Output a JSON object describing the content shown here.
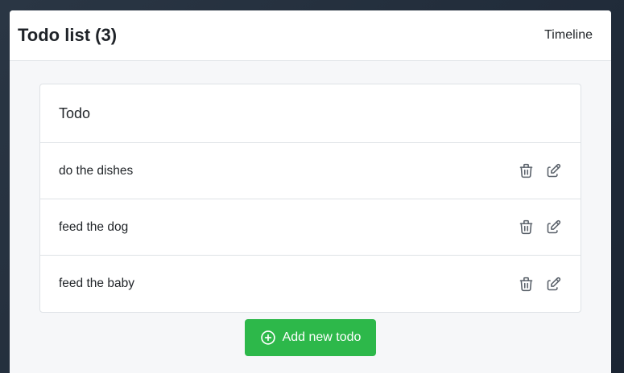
{
  "header": {
    "title": "Todo list (3)",
    "nav_link": "Timeline"
  },
  "card": {
    "heading": "Todo",
    "items": [
      {
        "text": "do the dishes"
      },
      {
        "text": "feed the dog"
      },
      {
        "text": "feed the baby"
      }
    ]
  },
  "actions": {
    "delete_icon": "trash-icon",
    "edit_icon": "pencil-square-icon",
    "add_label": "Add new todo",
    "add_icon": "plus-circle-icon"
  },
  "colors": {
    "primary_button": "#2db84a",
    "icon": "#5a616a"
  }
}
